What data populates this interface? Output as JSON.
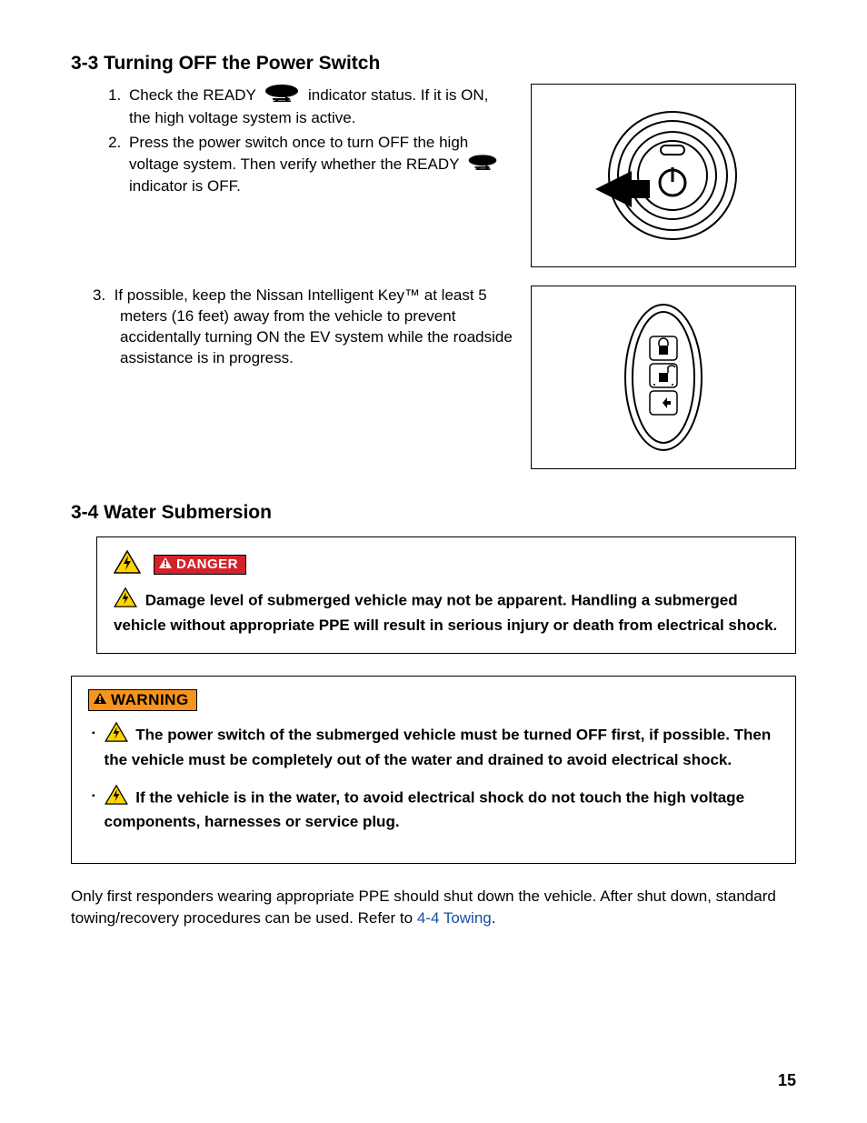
{
  "section33": {
    "heading": "3-3  Turning OFF the Power Switch",
    "step1_a": "Check the READY",
    "step1_b": "indicator status. If it is ON, the high voltage system is active.",
    "step2_a": "Press the power switch once to turn OFF the high voltage system. Then verify whether the READY",
    "step2_b": "indicator is OFF.",
    "step3_num": "3.",
    "step3": "If possible, keep the Nissan Intelligent Key™ at least 5 meters (16 feet) away from the vehicle to prevent accidentally turning ON the EV system while the roadside assistance is in progress."
  },
  "section34": {
    "heading": "3-4  Water Submersion",
    "danger_label": "DANGER",
    "danger_text": "Damage level of submerged vehicle may not be apparent. Handling a submerged vehicle without appropriate PPE will result in serious injury or death from electrical shock.",
    "warning_label": "WARNING",
    "warning_item1": "The power switch of the submerged vehicle must be turned OFF first, if possible. Then the vehicle must be completely out of the water and drained to avoid electrical shock.",
    "warning_item2": "If the vehicle is in the water, to avoid electrical shock do not touch the high voltage components, harnesses or service plug.",
    "body_a": "Only first responders wearing appropriate PPE should shut down the vehicle. After shut down, standard towing/recovery procedures can be used. Refer to ",
    "body_link": "4-4 Towing",
    "body_b": "."
  },
  "page_number": "15"
}
